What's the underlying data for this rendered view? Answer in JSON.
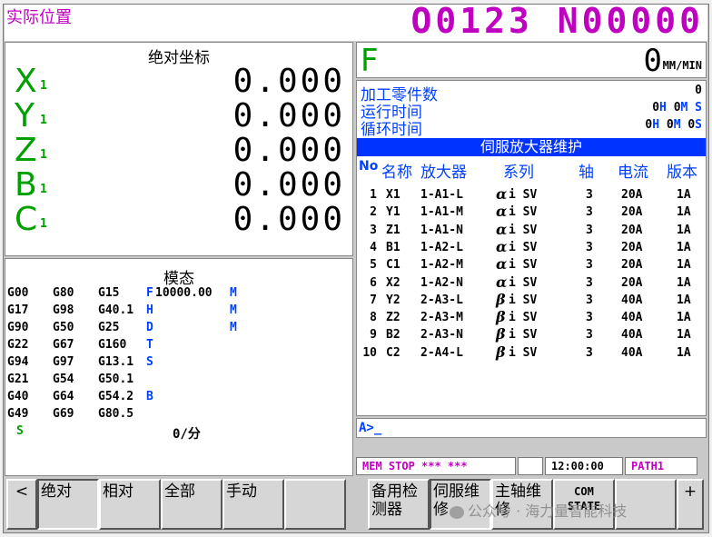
{
  "header": {
    "screen_title": "实际位置",
    "program_number": "O0123 N00000"
  },
  "absolute": {
    "title": "绝对坐标",
    "axes": [
      {
        "name": "X",
        "sub": "1",
        "value": "0.000"
      },
      {
        "name": "Y",
        "sub": "1",
        "value": "0.000"
      },
      {
        "name": "Z",
        "sub": "1",
        "value": "0.000"
      },
      {
        "name": "B",
        "sub": "1",
        "value": "0.000"
      },
      {
        "name": "C",
        "sub": "1",
        "value": "0.000"
      }
    ]
  },
  "modal": {
    "title": "模态",
    "rows": [
      [
        "G00",
        "G80",
        "G15",
        "F",
        "10000.00",
        "M"
      ],
      [
        "G17",
        "G98",
        "G40.1",
        "H",
        "",
        "M"
      ],
      [
        "G90",
        "G50",
        "G25",
        "D",
        "",
        "M"
      ],
      [
        "G22",
        "G67",
        "G160",
        "T",
        "",
        ""
      ],
      [
        "G94",
        "G97",
        "G13.1",
        "S",
        "",
        ""
      ],
      [
        "G21",
        "G54",
        "G50.1",
        "",
        "",
        ""
      ],
      [
        "G40",
        "G64",
        "G54.2",
        "B",
        "",
        ""
      ],
      [
        "G49",
        "G69",
        "G80.5",
        "",
        "",
        ""
      ]
    ],
    "spindle_label": "S",
    "spindle_value": "0/分"
  },
  "feed": {
    "letter": "F",
    "value": "0",
    "unit": "MM/MIN"
  },
  "counters": {
    "parts_label": "加工零件数",
    "parts_value": "0",
    "run_label": "运行时间",
    "run_h": "0",
    "run_m": "0",
    "run_s": "",
    "cycle_label": "循环时间",
    "cycle_h": "0",
    "cycle_m": "0",
    "cycle_s": "0"
  },
  "units": {
    "h": "H",
    "m": "M",
    "s": "S"
  },
  "servo": {
    "header": "伺服放大器维护",
    "columns": {
      "no": "No",
      "name": "名称",
      "amp": "放大器",
      "series": "系列",
      "axis": "轴",
      "current": "电流",
      "version": "版本"
    },
    "rows": [
      {
        "no": "1",
        "name": "X1",
        "amp": "1-A1-L",
        "greek": "α",
        "series": "i SV",
        "axis": "3",
        "current": "20A",
        "version": "1A"
      },
      {
        "no": "2",
        "name": "Y1",
        "amp": "1-A1-M",
        "greek": "α",
        "series": "i SV",
        "axis": "3",
        "current": "20A",
        "version": "1A"
      },
      {
        "no": "3",
        "name": "Z1",
        "amp": "1-A1-N",
        "greek": "α",
        "series": "i SV",
        "axis": "3",
        "current": "20A",
        "version": "1A"
      },
      {
        "no": "4",
        "name": "B1",
        "amp": "1-A2-L",
        "greek": "α",
        "series": "i SV",
        "axis": "3",
        "current": "20A",
        "version": "1A"
      },
      {
        "no": "5",
        "name": "C1",
        "amp": "1-A2-M",
        "greek": "α",
        "series": "i SV",
        "axis": "3",
        "current": "20A",
        "version": "1A"
      },
      {
        "no": "6",
        "name": "X2",
        "amp": "1-A2-N",
        "greek": "α",
        "series": "i SV",
        "axis": "3",
        "current": "20A",
        "version": "1A"
      },
      {
        "no": "7",
        "name": "Y2",
        "amp": "2-A3-L",
        "greek": "β",
        "series": "i SV",
        "axis": "3",
        "current": "40A",
        "version": "1A"
      },
      {
        "no": "8",
        "name": "Z2",
        "amp": "2-A3-M",
        "greek": "β",
        "series": "i SV",
        "axis": "3",
        "current": "40A",
        "version": "1A"
      },
      {
        "no": "9",
        "name": "B2",
        "amp": "2-A3-N",
        "greek": "β",
        "series": "i SV",
        "axis": "3",
        "current": "40A",
        "version": "1A"
      },
      {
        "no": "10",
        "name": "C2",
        "amp": "2-A4-L",
        "greek": "β",
        "series": "i SV",
        "axis": "3",
        "current": "40A",
        "version": "1A"
      }
    ]
  },
  "input": {
    "prompt": "A>_"
  },
  "status": {
    "mode": "MEM  STOP *** ***",
    "clock": "12:00:00",
    "path": "PATH1"
  },
  "softkeys": {
    "prev": "<",
    "k1": "绝对",
    "k2": "相对",
    "k3": "全部",
    "k4": "手动",
    "k5": "",
    "k6": "备用检测器",
    "k7": "伺服维修",
    "k8": "主轴维修",
    "k9_line1": "COM",
    "k9_line2": "STATE",
    "k10": "",
    "next": "+"
  },
  "watermark": "公众号 · 海力量智能科技",
  "colors": {
    "title_magenta": "#c000c0",
    "axis_green": "#00a000",
    "label_blue": "#0040ff",
    "header_blue": "#0033ff"
  }
}
